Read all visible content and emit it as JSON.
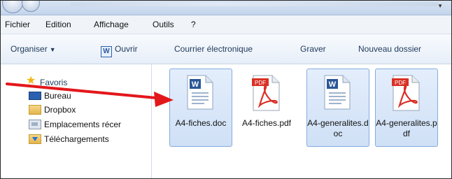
{
  "menu": [
    "Fichier",
    "Edition",
    "Affichage",
    "Outils",
    "?"
  ],
  "toolbar": {
    "organize": "Organiser",
    "open": "Ouvrir",
    "email": "Courrier électronique",
    "burn": "Graver",
    "new_folder": "Nouveau dossier"
  },
  "nav": {
    "favorites": "Favoris",
    "items": [
      "Bureau",
      "Dropbox",
      "Emplacements récer",
      "Téléchargements"
    ]
  },
  "files": [
    {
      "name": "A4-fiches.doc",
      "type": "word",
      "selected": true
    },
    {
      "name": "A4-fiches.pdf",
      "type": "pdf",
      "selected": false
    },
    {
      "name": "A4-generalites.doc",
      "type": "word",
      "selected": true
    },
    {
      "name": "A4-generalites.pdf",
      "type": "pdf",
      "selected": true
    }
  ],
  "colors": {
    "accent": "#2b5797",
    "selection": "#cfe0f6",
    "pdf_red": "#d93025",
    "arrow_red": "#e3171b"
  }
}
